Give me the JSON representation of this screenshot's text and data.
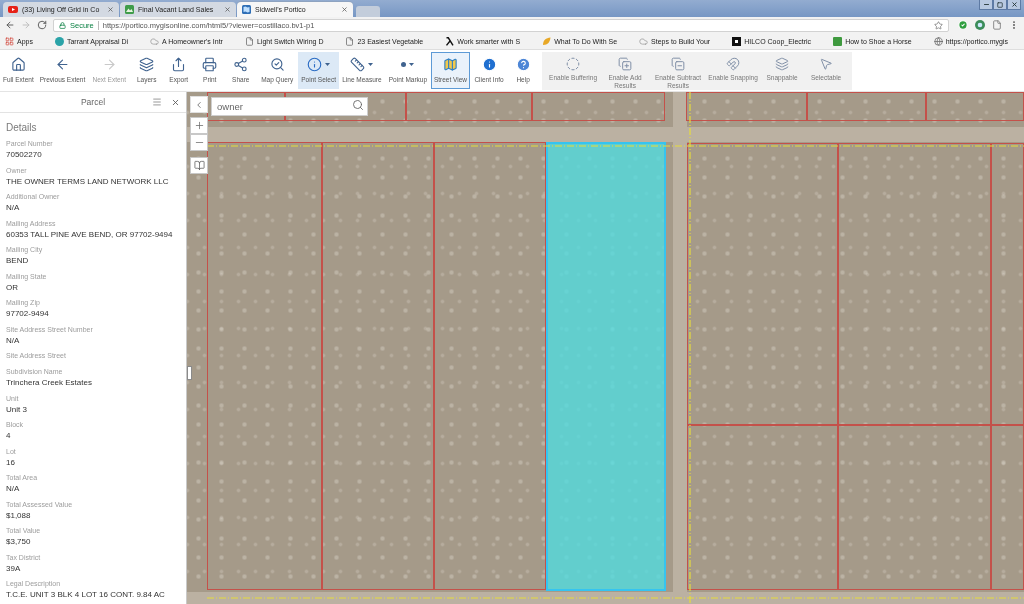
{
  "browser": {
    "tabs": [
      {
        "title": "(33) Living Off Grid in Co",
        "selected": false
      },
      {
        "title": "Final Vacant Land Sales",
        "selected": false
      },
      {
        "title": "Sidwell's Portico",
        "selected": true
      }
    ],
    "address_bar": {
      "security": "Secure",
      "url": "https://portico.mygisonline.com/html5/?viewer=costillaco.bv1-p1"
    },
    "bookmarks": [
      "Apps",
      "Tarrant Appraisal Di",
      "A Homeowner's Intr",
      "Light Switch Wiring D",
      "23 Easiest Vegetable",
      "Work smarter with S",
      "What To Do With Se",
      "Steps to Build Your",
      "HILCO Coop_Electric",
      "How to Shoe a Horse",
      "https://portico.mygis"
    ]
  },
  "toolbar": {
    "tools": [
      {
        "label": "Full Extent",
        "selected": false,
        "disabled": false,
        "has_menu": false
      },
      {
        "label": "Previous Extent",
        "selected": false,
        "disabled": false,
        "has_menu": false
      },
      {
        "label": "Next Extent",
        "selected": false,
        "disabled": true,
        "has_menu": false
      },
      {
        "label": "Layers",
        "selected": false,
        "disabled": false,
        "has_menu": false
      },
      {
        "label": "Export",
        "selected": false,
        "disabled": false,
        "has_menu": false
      },
      {
        "label": "Print",
        "selected": false,
        "disabled": false,
        "has_menu": false
      },
      {
        "label": "Share",
        "selected": false,
        "disabled": false,
        "has_menu": false
      },
      {
        "label": "Map Query",
        "selected": false,
        "disabled": false,
        "has_menu": false
      },
      {
        "label": "Point Select",
        "selected": true,
        "disabled": false,
        "has_menu": true
      },
      {
        "label": "Line Measure",
        "selected": false,
        "disabled": false,
        "has_menu": true
      },
      {
        "label": "Point Markup",
        "selected": false,
        "disabled": false,
        "has_menu": true
      },
      {
        "label": "Street View",
        "selected": true,
        "disabled": false,
        "has_menu": false
      },
      {
        "label": "Client Info",
        "selected": false,
        "disabled": false,
        "has_menu": false
      },
      {
        "label": "Help",
        "selected": false,
        "disabled": false,
        "has_menu": false
      }
    ],
    "options": [
      "Enable Buffering",
      "Enable Add Results",
      "Enable Subtract Results",
      "Enable Snapping",
      "Snappable",
      "Selectable"
    ]
  },
  "panel": {
    "title": "Parcel",
    "section": "Details",
    "fields": [
      {
        "label": "Parcel Number",
        "value": "70502270"
      },
      {
        "label": "Owner",
        "value": "THE OWNER TERMS LAND NETWORK LLC"
      },
      {
        "label": "Additional Owner",
        "value": "N/A"
      },
      {
        "label": "Mailing Address",
        "value": "60353 TALL PINE AVE BEND, OR 97702-9494"
      },
      {
        "label": "Mailing City",
        "value": "BEND"
      },
      {
        "label": "Mailing State",
        "value": "OR"
      },
      {
        "label": "Mailing Zip",
        "value": "97702-9494"
      },
      {
        "label": "Site Address Street Number",
        "value": "N/A"
      },
      {
        "label": "Site Address Street"
      },
      {
        "label": "Subdivision Name",
        "value": "Trinchera Creek Estates"
      },
      {
        "label": "Unit",
        "value": "Unit 3"
      },
      {
        "label": "Block",
        "value": "4"
      },
      {
        "label": "Lot",
        "value": "16"
      },
      {
        "label": "Total Area",
        "value": "N/A"
      },
      {
        "label": "Total Assessed Value",
        "value": "$1,088"
      },
      {
        "label": "Total Value",
        "value": "$3,750"
      },
      {
        "label": "Tax District",
        "value": "39A"
      },
      {
        "label": "Legal Description",
        "value": "T.C.E. UNIT 3 BLK 4 LOT 16 CONT. 9.84 AC"
      }
    ]
  },
  "map": {
    "search": {
      "value": "owner"
    },
    "parcels": [
      {
        "selected": false
      },
      {
        "selected": false
      },
      {
        "selected": false
      },
      {
        "selected": false
      },
      {
        "selected": false
      },
      {
        "selected": false
      },
      {
        "selected": false
      },
      {
        "selected": false
      },
      {
        "selected": false
      },
      {
        "selected": false
      },
      {
        "selected": true
      },
      {
        "selected": false
      },
      {
        "selected": false
      },
      {
        "selected": false
      },
      {
        "selected": false
      },
      {
        "selected": false
      },
      {
        "selected": false
      }
    ]
  }
}
